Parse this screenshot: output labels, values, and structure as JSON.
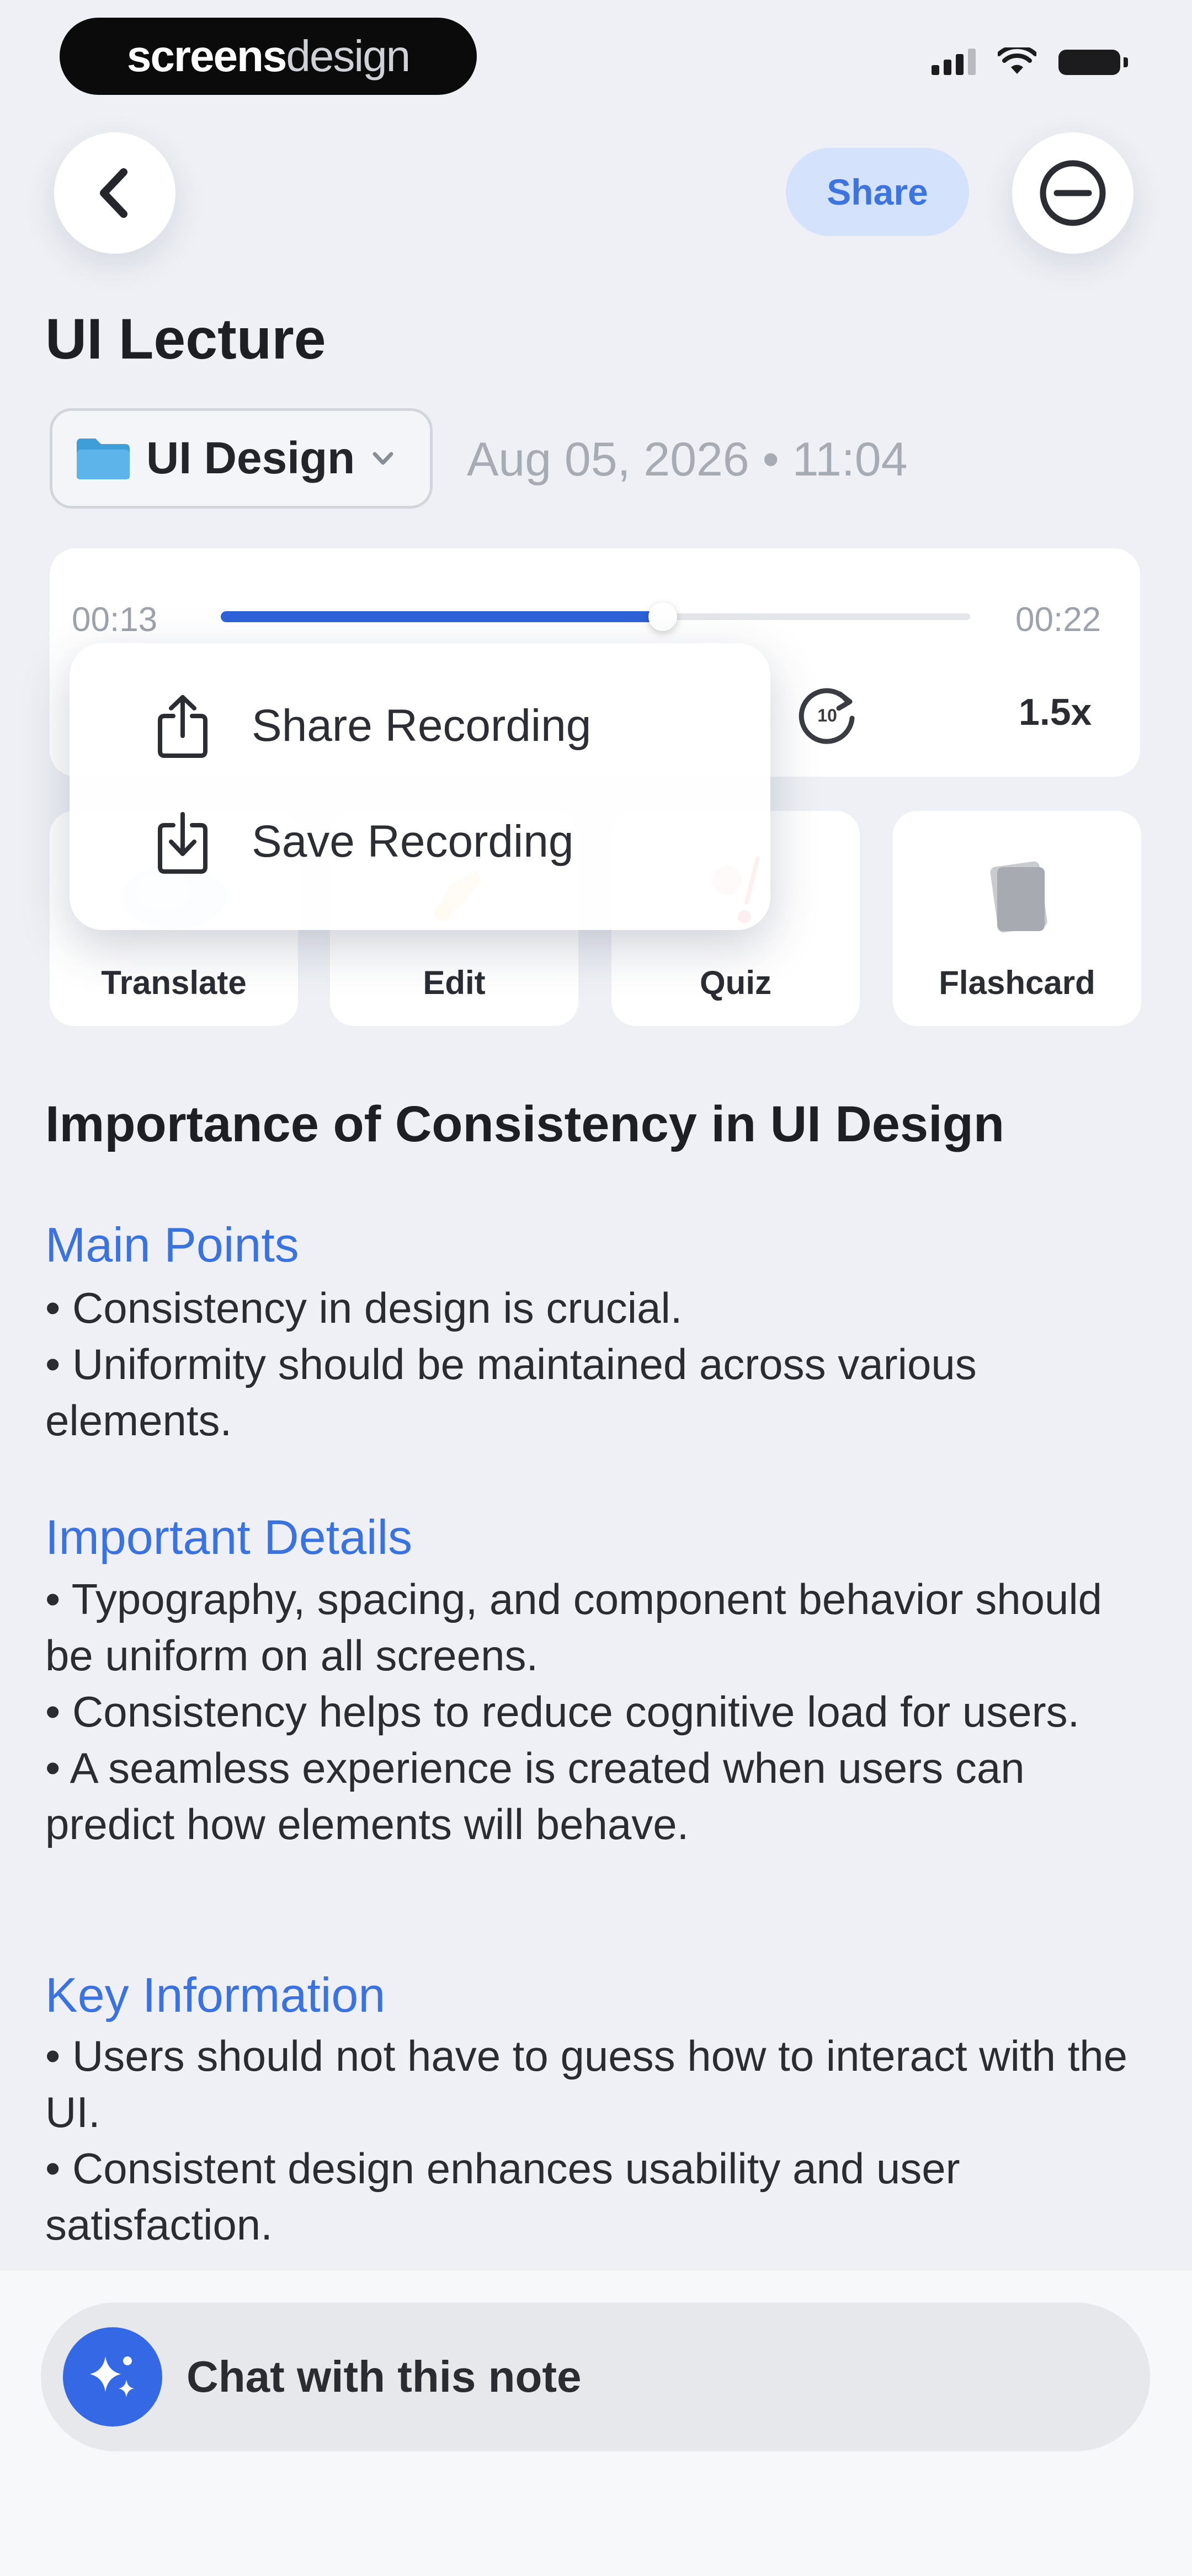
{
  "status_bar": {
    "brand_bold": "screens",
    "brand_light": "design",
    "icons": [
      "signal-icon",
      "wifi-icon",
      "battery-icon"
    ]
  },
  "header": {
    "back_icon": "chevron-left-icon",
    "share_label": "Share",
    "more_icon": "minus-circle-icon"
  },
  "note": {
    "title": "UI Lecture",
    "folder": "UI Design",
    "date": "Aug 05, 2026 • 11:04"
  },
  "player": {
    "elapsed": "00:13",
    "duration": "00:22",
    "progress_fraction": 0.59,
    "speed": "1.5x",
    "skip_icon": "rotate-forward-10-icon"
  },
  "menu": {
    "items": [
      {
        "label": "Share Recording",
        "icon": "share-icon"
      },
      {
        "label": "Save Recording",
        "icon": "download-icon"
      }
    ]
  },
  "tools": [
    {
      "label": "Translate"
    },
    {
      "label": "Edit"
    },
    {
      "label": "Quiz"
    },
    {
      "label": "Flashcard"
    }
  ],
  "content": {
    "heading": "Importance of Consistency in UI Design",
    "sections": [
      {
        "title": "Main Points",
        "lines": [
          "• Consistency in design is crucial.",
          "• Uniformity should be maintained across various elements."
        ]
      },
      {
        "title": "Important Details",
        "lines": [
          "• Typography, spacing, and component behavior should be uniform on all screens.",
          "• Consistency helps to reduce cognitive load for users.",
          "• A seamless experience is created when users can predict how elements will behave."
        ]
      },
      {
        "title": "Key Information",
        "lines": [
          "• Users should not have to guess how to interact with the UI.",
          "• Consistent design enhances usability and user satisfaction."
        ]
      }
    ]
  },
  "chat": {
    "label": "Chat with this note",
    "icon": "sparkles-icon"
  },
  "colors": {
    "accent": "#3568e4",
    "background": "#eef0f5",
    "section_heading": "#3a73e0"
  }
}
